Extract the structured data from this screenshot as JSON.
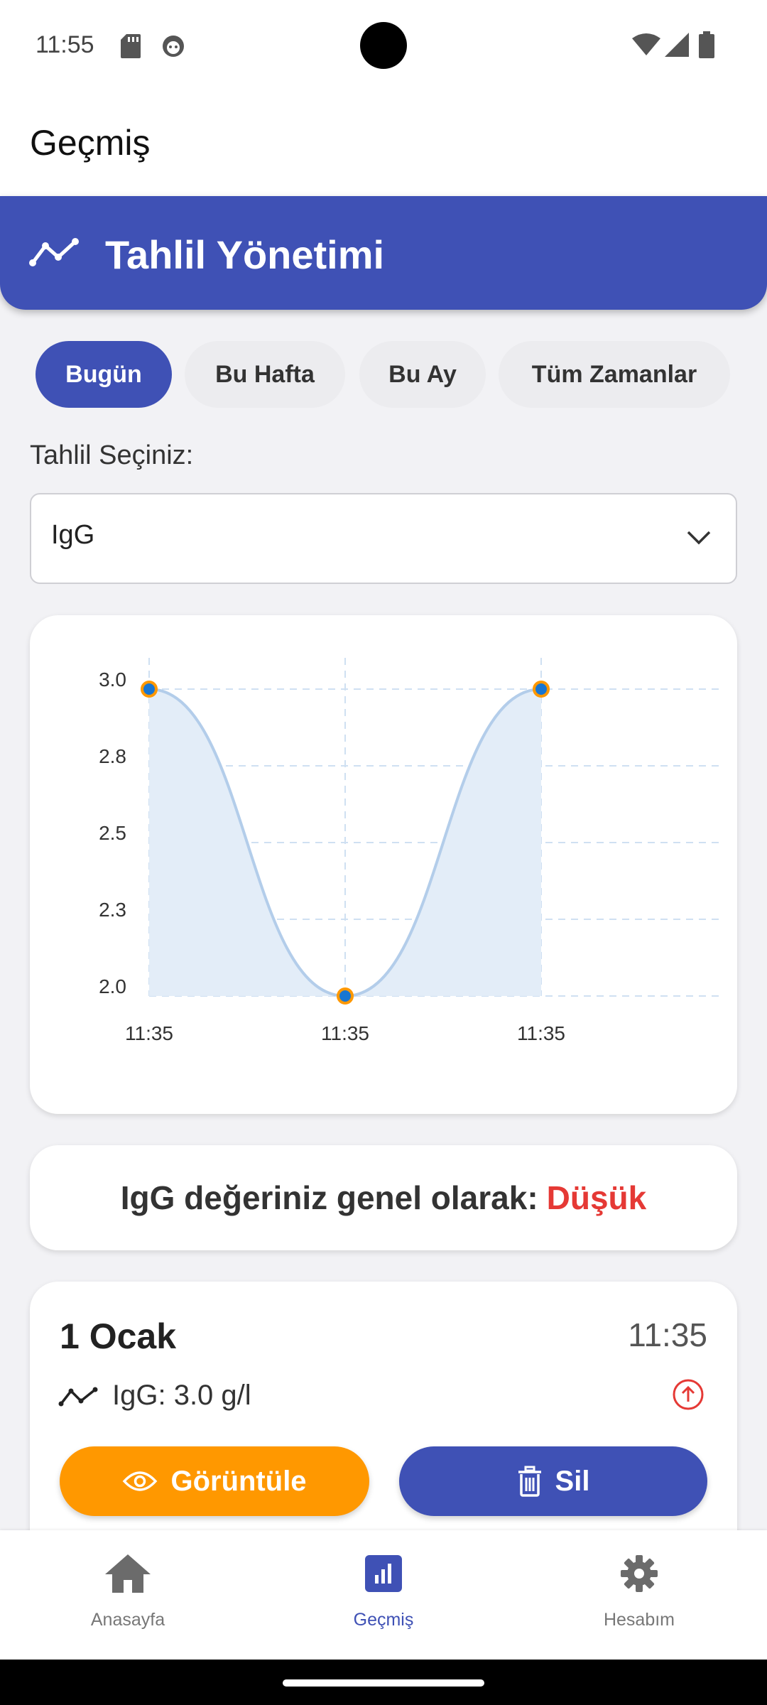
{
  "status_bar": {
    "time": "11:55"
  },
  "app_bar": {
    "title": "Geçmiş"
  },
  "banner": {
    "title": "Tahlil Yönetimi",
    "icon": "trend-line-icon"
  },
  "filters": [
    {
      "label": "Bugün",
      "active": true
    },
    {
      "label": "Bu Hafta",
      "active": false
    },
    {
      "label": "Bu Ay",
      "active": false
    },
    {
      "label": "Tüm Zamanlar",
      "active": false
    }
  ],
  "test_select": {
    "label": "Tahlil Seçiniz:",
    "value": "IgG"
  },
  "chart_data": {
    "type": "line",
    "x": [
      "11:35",
      "11:35",
      "11:35"
    ],
    "series": [
      {
        "values": [
          3.0,
          2.0,
          3.0
        ]
      }
    ],
    "y_ticks": [
      "3.0",
      "2.8",
      "2.5",
      "2.3",
      "2.0"
    ],
    "ylim": [
      2.0,
      3.0
    ],
    "grid": true,
    "line_color": "#b3cdea",
    "fill_color": "#e3edf8",
    "point_color": "#1976d2",
    "point_border_color": "#ff9800"
  },
  "summary": {
    "prefix": "IgG değeriniz genel olarak:",
    "status": "Düşük",
    "status_color": "#e53935"
  },
  "record": {
    "date": "1 Ocak",
    "time": "11:35",
    "value_text": "IgG: 3.0 g/l",
    "view_button": "Görüntüle",
    "delete_button": "Sil"
  },
  "bottom_nav": [
    {
      "label": "Anasayfa",
      "icon": "home-icon",
      "active": false
    },
    {
      "label": "Geçmiş",
      "icon": "bar-chart-icon",
      "active": true
    },
    {
      "label": "Hesabım",
      "icon": "gear-icon",
      "active": false
    }
  ]
}
